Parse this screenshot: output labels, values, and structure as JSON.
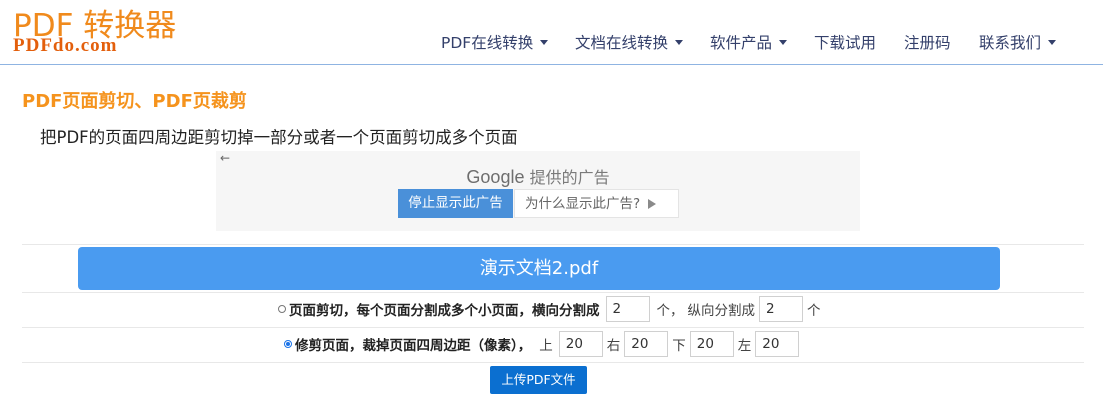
{
  "header": {
    "logo_title": "PDF 转换器",
    "logo_sub": "PDFdo.com",
    "nav": [
      {
        "label": "PDF在线转换",
        "dropdown": true
      },
      {
        "label": "文档在线转换",
        "dropdown": true
      },
      {
        "label": "软件产品",
        "dropdown": true
      },
      {
        "label": "下载试用",
        "dropdown": false
      },
      {
        "label": "注册码",
        "dropdown": false
      },
      {
        "label": "联系我们",
        "dropdown": true
      }
    ]
  },
  "main": {
    "title": "PDF页面剪切、PDF页裁剪",
    "description": "把PDF的页面四周边距剪切掉一部分或者一个页面剪切成多个页面"
  },
  "ad": {
    "back_arrow": "←",
    "google": "Google",
    "provider": "提供的广告",
    "stop_label": "停止显示此广告",
    "why_label": "为什么显示此广告?"
  },
  "file": {
    "name": "演示文档2.pdf"
  },
  "options": {
    "cut": {
      "selected": false,
      "label": "页面剪切，每个页面分割成多个小页面，横向分割成",
      "h_value": "2",
      "h_unit": "个，",
      "v_label": "纵向分割成",
      "v_value": "2",
      "v_unit": "个"
    },
    "trim": {
      "selected": true,
      "label": "修剪页面，裁掉页面四周边距（像素），",
      "top_label": "上",
      "top_value": "20",
      "right_label": "右",
      "right_value": "20",
      "bottom_label": "下",
      "bottom_value": "20",
      "left_label": "左",
      "left_value": "20"
    }
  },
  "upload": {
    "label": "上传PDF文件"
  },
  "colors": {
    "brand_orange": "#f08a1c",
    "title_orange": "#f5931d",
    "nav_text": "#34406b",
    "file_bar": "#4a9bf0",
    "upload_button": "#0b6fd0",
    "ad_stop_button": "#4a90d9"
  }
}
